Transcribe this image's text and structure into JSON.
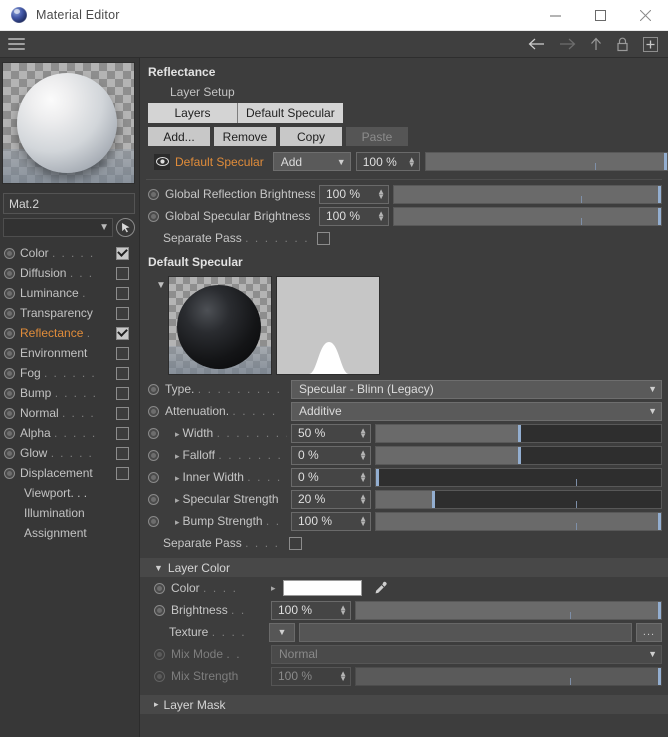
{
  "window": {
    "title": "Material Editor",
    "icon": "cinema4d-logo-icon",
    "minimize": "—",
    "maximize": "□",
    "close": "✕"
  },
  "toolstrip": {
    "menu_icon": "hamburger-menu-icon",
    "back": "back-arrow-icon",
    "forward": "forward-arrow-icon",
    "up": "up-arrow-icon",
    "lock": "lock-icon",
    "add": "add-box-icon"
  },
  "sidebar": {
    "material_name": "Mat.2",
    "search_value": "",
    "channels": [
      {
        "label": "Color",
        "dots": ". . . . .",
        "checked": true,
        "active": false
      },
      {
        "label": "Diffusion",
        "dots": ". . .",
        "checked": false,
        "active": false
      },
      {
        "label": "Luminance",
        "dots": ".",
        "checked": false,
        "active": false
      },
      {
        "label": "Transparency",
        "dots": "",
        "checked": false,
        "active": false
      },
      {
        "label": "Reflectance",
        "dots": ".",
        "checked": true,
        "active": true
      },
      {
        "label": "Environment",
        "dots": "",
        "checked": false,
        "active": false
      },
      {
        "label": "Fog",
        "dots": ". . . . . .",
        "checked": false,
        "active": false
      },
      {
        "label": "Bump",
        "dots": ". . . . .",
        "checked": false,
        "active": false
      },
      {
        "label": "Normal",
        "dots": ". . . .",
        "checked": false,
        "active": false
      },
      {
        "label": "Alpha",
        "dots": ". . . . .",
        "checked": false,
        "active": false
      },
      {
        "label": "Glow",
        "dots": ". . . . .",
        "checked": false,
        "active": false
      },
      {
        "label": "Displacement",
        "dots": "",
        "checked": false,
        "active": false
      }
    ],
    "links": [
      {
        "label": "Viewport. . ."
      },
      {
        "label": "Illumination"
      },
      {
        "label": "Assignment"
      }
    ]
  },
  "reflectance": {
    "title": "Reflectance",
    "layer_setup_label": "Layer Setup",
    "tabs": [
      {
        "label": "Layers",
        "selected": true
      },
      {
        "label": "Default Specular",
        "selected": false
      }
    ],
    "buttons": [
      {
        "label": "Add...",
        "disabled": false
      },
      {
        "label": "Remove",
        "disabled": false
      },
      {
        "label": "Copy",
        "disabled": false
      },
      {
        "label": "Paste",
        "disabled": true
      }
    ],
    "layer": {
      "visibility_icon": "eye-icon",
      "name": "Default Specular",
      "blend_mode": "Add",
      "opacity": "100 %",
      "opacity_pct": 100,
      "tick_pct": 70
    },
    "global_reflection_brightness": {
      "label": "Global Reflection Brightness",
      "value": "100 %",
      "pct": 100,
      "tick_pct": 70
    },
    "global_specular_brightness": {
      "label": "Global Specular Brightness",
      "value": "100 %",
      "pct": 100,
      "tick_pct": 70
    },
    "separate_pass_global": {
      "label": "Separate Pass",
      "dots": ". . . . . . . . . .",
      "checked": false
    }
  },
  "default_specular": {
    "title": "Default Specular",
    "type": {
      "label": "Type.",
      "dots": ". . . . . . . . . .",
      "value": "Specular - Blinn (Legacy)"
    },
    "attenuation": {
      "label": "Attenuation.",
      "dots": ". . . . .",
      "value": "Additive"
    },
    "sliders": [
      {
        "label": "Width",
        "dots": ". . . . . . . .",
        "value": "50 %",
        "pct": 50,
        "tick_pct": 70
      },
      {
        "label": "Falloff",
        "dots": ". . . . . . . .",
        "value": "0 %",
        "pct": 50,
        "tick_pct": 70
      },
      {
        "label": "Inner Width",
        "dots": ". . . .",
        "value": "0 %",
        "pct": 0,
        "tick_pct": 70
      },
      {
        "label": "Specular Strength",
        "dots": "",
        "value": "20 %",
        "pct": 20,
        "tick_pct": 70
      },
      {
        "label": "Bump Strength",
        "dots": ". .",
        "value": "100 %",
        "pct": 100,
        "tick_pct": 70
      }
    ],
    "separate_pass": {
      "label": "Separate Pass",
      "dots": ". . . .",
      "checked": false
    }
  },
  "layer_color": {
    "title": "Layer Color",
    "expanded": true,
    "color": {
      "label": "Color",
      "dots": ". . . .",
      "swatch_hex": "#ffffff",
      "eyedropper_icon": "eyedropper-icon"
    },
    "brightness": {
      "label": "Brightness",
      "dots": ". .",
      "value": "100 %",
      "pct": 100,
      "tick_pct": 70
    },
    "texture": {
      "label": "Texture",
      "dots": ". . . .",
      "value": "",
      "browse_label": "...",
      "dropdown_icon": "chevron-down-icon"
    },
    "mix_mode": {
      "label": "Mix Mode",
      "dots": ". .",
      "value": "Normal",
      "disabled": true
    },
    "mix_strength": {
      "label": "Mix Strength",
      "dots": "",
      "value": "100 %",
      "pct": 100,
      "tick_pct": 70,
      "disabled": true
    }
  },
  "layer_mask": {
    "title": "Layer Mask",
    "expanded": false
  },
  "colors": {
    "accent_orange": "#e08c3a",
    "panel_bg": "#3d3d3d",
    "sidebar_bg": "#373737",
    "slider_fill": "#6a6a6a",
    "slider_handle": "#93aed0"
  }
}
